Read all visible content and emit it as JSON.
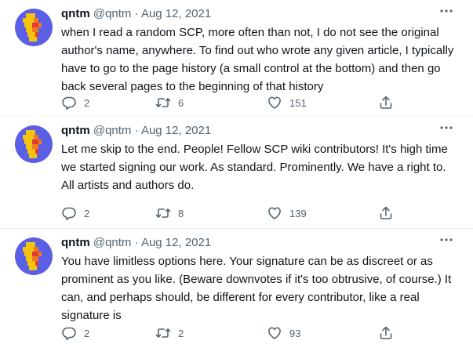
{
  "tweets": [
    {
      "name": "qntm",
      "handle": "@qntm",
      "separator": "·",
      "date": "Aug 12, 2021",
      "text": "when I read a random SCP, more often than not, I do not see the original author's name, anywhere. To find out who wrote any given article, I typically have to go to the page history (a small control at the bottom) and then go back several pages to the beginning of that history",
      "replies": "2",
      "retweets": "6",
      "likes": "151"
    },
    {
      "name": "qntm",
      "handle": "@qntm",
      "separator": "·",
      "date": "Aug 12, 2021",
      "text": "Let me skip to the end. People! Fellow SCP wiki contributors! It's high time we started signing our work. As standard. Prominently. We have a right to. All artists and authors do.",
      "replies": "2",
      "retweets": "8",
      "likes": "139"
    },
    {
      "name": "qntm",
      "handle": "@qntm",
      "separator": "·",
      "date": "Aug 12, 2021",
      "text": "You have limitless options here. Your signature can be as discreet or as prominent as you like. (Beware downvotes if it's too obtrusive, of course.) It can, and perhaps should, be different for every contributor, like a real signature is",
      "replies": "2",
      "retweets": "2",
      "likes": "93"
    }
  ],
  "icons": {
    "avatar": "avatar-image",
    "more": "more-icon",
    "reply": "reply-icon",
    "retweet": "retweet-icon",
    "like": "heart-icon",
    "share": "share-icon"
  },
  "colors": {
    "avatar_bg": "#5b5fe6",
    "avatar_yellow": "#f2c40f",
    "avatar_orange": "#f07b1e",
    "avatar_red": "#e53935",
    "secondary_text": "#536471",
    "divider": "#eff3f4"
  }
}
